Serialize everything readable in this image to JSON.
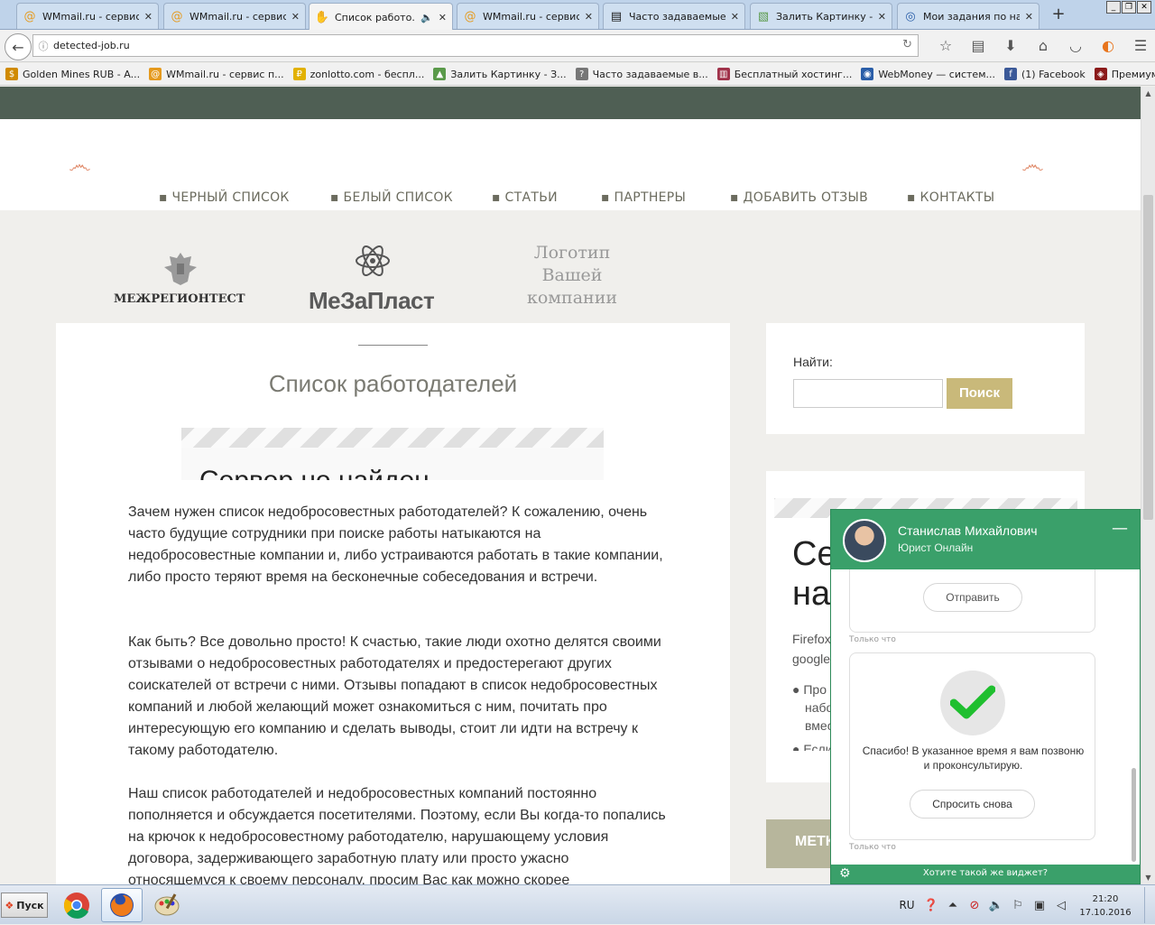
{
  "browser": {
    "tabs": [
      {
        "title": "WMmail.ru - сервис...",
        "icon": "wmmail-icon",
        "active": false
      },
      {
        "title": "WMmail.ru - сервис...",
        "icon": "wmmail-icon",
        "active": false
      },
      {
        "title": "Список работо...",
        "icon": "hand-icon",
        "active": true
      },
      {
        "title": "WMmail.ru - сервис...",
        "icon": "wmmail-icon",
        "active": false
      },
      {
        "title": "Часто задаваемые...",
        "icon": "page-icon",
        "active": false
      },
      {
        "title": "Залить Картинку -...",
        "icon": "image-icon",
        "active": false
      },
      {
        "title": "Мои задания по на...",
        "icon": "globe-icon",
        "active": false
      }
    ],
    "new_tab": "+",
    "url": "detected-job.ru",
    "bookmarks": [
      {
        "label": "Golden Mines RUB - A...",
        "icon": "coin-icon",
        "color": "#d08a00"
      },
      {
        "label": "WMmail.ru - сервис п...",
        "icon": "wmmail-icon",
        "color": "#e59a1e"
      },
      {
        "label": "zonlotto.com - беспл...",
        "icon": "ruble-icon",
        "color": "#e2b100"
      },
      {
        "label": "Залить Картинку - З...",
        "icon": "image-icon",
        "color": "#5a9a4a"
      },
      {
        "label": "Часто задаваемые в...",
        "icon": "page-icon",
        "color": "#777777"
      },
      {
        "label": "Бесплатный хостинг...",
        "icon": "hosting-icon",
        "color": "#a0324a"
      },
      {
        "label": "WebMoney — систем...",
        "icon": "globe-icon",
        "color": "#2a5ea8"
      },
      {
        "label": "(1) Facebook",
        "icon": "facebook-icon",
        "color": "#3b5998"
      },
      {
        "label": "Премиум магазин Wa...",
        "icon": "shop-icon",
        "color": "#8b1a1a"
      }
    ]
  },
  "site": {
    "menu": [
      {
        "label": "▪ ЧЕРНЫЙ СПИСОК"
      },
      {
        "label": "▪ БЕЛЫЙ СПИСОК"
      },
      {
        "label": "▪ СТАТЬИ"
      },
      {
        "label": "▪ ПАРТНЕРЫ"
      },
      {
        "label": "▪ ДОБАВИТЬ ОТЗЫВ"
      },
      {
        "label": "▪ КОНТАКТЫ"
      }
    ],
    "logos": {
      "logo1": "МЕЖРЕГИОНТЕСТ",
      "logo2": "МеЗаПласт",
      "logo3_line1": "Логотип",
      "logo3_line2": "Вашей",
      "logo3_line3": "компании"
    },
    "page_title": "Список работодателей",
    "embedded_error": "Сервер не найден",
    "paragraphs": [
      "Зачем нужен список недобросовестных работодателей? К сожалению, очень часто будущие сотрудники при поиске работы натыкаются на недобросовестные компании и, либо устраиваются работать в такие компании, либо просто теряют время на бесконечные собеседования и встречи.",
      "Как быть? Все довольно просто! К счастью, такие люди охотно делятся своими отзывами о недобросовестных работодателях и предостерегают других соискателей от встречи с ними. Отзывы попадают в список недобросовестных компаний и любой желающий может ознакомиться с ним, почитать про интересующую его компанию и сделать выводы, стоит ли идти на встречу к такому работодателю.",
      "Наш список работодателей и недобросовестных компаний постоянно пополняется и обсуждается посетителями. Поэтому, если Вы когда-то попались на крючок к недобросовестному работодателю, нарушающему условия договора, задерживающего заработную плату или просто ужасно относящемуся к своему персоналу, просим Вас как можно скорее"
    ],
    "search": {
      "label": "Найти:",
      "button": "Поиск",
      "value": ""
    },
    "sidebar_widget": {
      "big_line1": "Се",
      "big_line2": "на",
      "small_line1": "Firefox",
      "small_line2": "google",
      "bullet1_l1": "Про",
      "bullet1_l2": "набо",
      "bullet1_l3": "вмес",
      "bullet2_l1": "Если"
    },
    "sidebar_heading": "МЕТК"
  },
  "chat": {
    "operator_name": "Станислав Михайлович",
    "operator_role": "Юрист Онлайн",
    "send_button": "Отправить",
    "timestamp1": "Только что",
    "thanks_message": "Спасибо! В указанное время я вам позвоню и проконсультирую.",
    "ask_again_button": "Спросить снова",
    "timestamp2": "Только что",
    "footer_link": "Хотите такой же виджет?"
  },
  "taskbar": {
    "start": "Пуск",
    "lang": "RU",
    "time": "21:20",
    "date": "17.10.2016"
  },
  "colors": {
    "header_band": "#4f5f54",
    "accent_tan": "#c9b97a",
    "chat_green": "#3aa06a",
    "ornament": "#e08a6a"
  }
}
